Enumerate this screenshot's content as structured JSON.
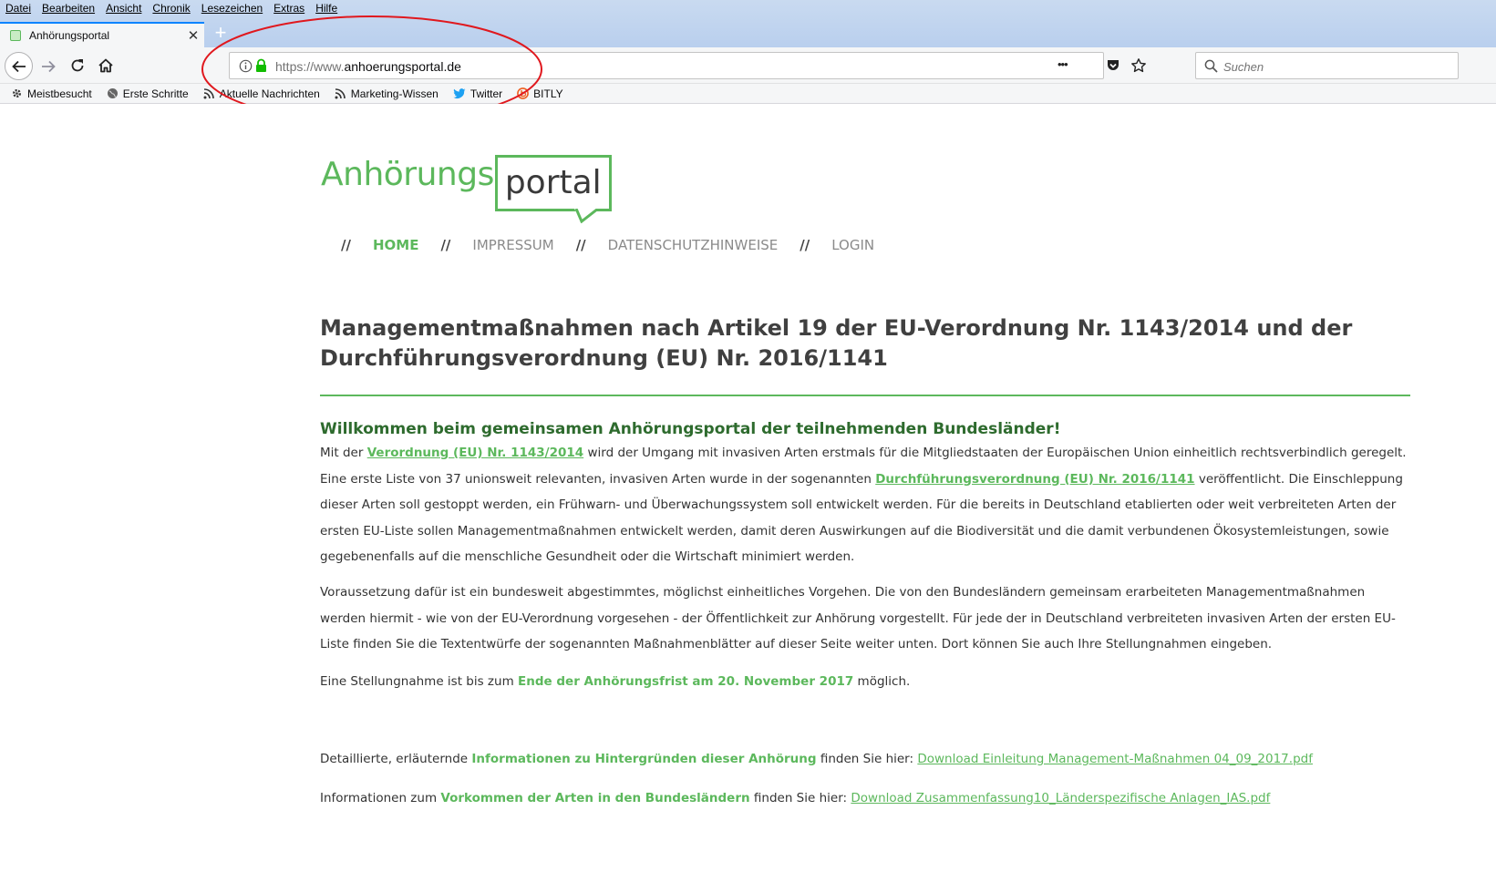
{
  "menu": [
    "Datei",
    "Bearbeiten",
    "Ansicht",
    "Chronik",
    "Lesezeichen",
    "Extras",
    "Hilfe"
  ],
  "tab": {
    "title": "Anhörungsportal",
    "close": "✕",
    "newtab": "+"
  },
  "urlbar": {
    "protocol": "https://www.",
    "domain": "anhoerungsportal.de",
    "more": "•••"
  },
  "search": {
    "placeholder": "Suchen"
  },
  "bookmarks": [
    "Meistbesucht",
    "Erste Schritte",
    "Aktuelle Nachrichten",
    "Marketing-Wissen",
    "Twitter",
    "BITLY"
  ],
  "logo": {
    "left": "Anhörungs",
    "right": "portal"
  },
  "nav": {
    "sep": "//",
    "items": [
      "HOME",
      "IMPRESSUM",
      "DATENSCHUTZHINWEISE",
      "LOGIN"
    ]
  },
  "title": "Managementmaßnahmen nach Artikel 19 der EU-Verordnung Nr. 1143/2014 und der Durchführungsverordnung (EU) Nr. 2016/1141",
  "welcome": "Willkommen beim gemeinsamen Anhörungsportal der teilnehmenden Bundesländer!",
  "para1": {
    "t1": "Mit der ",
    "link1": "Verordnung (EU) Nr. 1143/2014",
    "t2": " wird der Umgang mit invasiven Arten erstmals für die Mitgliedstaaten der Europäischen Union einheitlich rechtsverbindlich geregelt. Eine erste Liste von 37 unionsweit relevanten, invasiven Arten wurde in der sogenannten ",
    "link2": "Durchführungsverordnung (EU) Nr. 2016/1141",
    "t3": " veröffentlicht. Die Einschleppung dieser Arten soll gestoppt werden, ein Frühwarn- und Überwachungssystem soll entwickelt werden. Für die bereits in Deutschland etablierten oder weit verbreiteten Arten der ersten EU-Liste sollen Managementmaßnahmen entwickelt werden, damit deren Auswirkungen auf die Biodiversität und die damit verbundenen Ökosystemleistungen, sowie gegebenenfalls auf die menschliche Gesundheit oder die Wirtschaft minimiert werden."
  },
  "para2": "Voraussetzung dafür ist ein bundesweit abgestimmtes, möglichst einheitliches Vorgehen. Die von den Bundesländern gemeinsam erarbeiteten Managementmaßnahmen werden hiermit - wie von der EU-Verordnung vorgesehen - der Öffentlichkeit zur Anhörung vorgestellt. Für jede der in Deutschland verbreiteten invasiven Arten der ersten EU-Liste finden Sie die Textentwürfe der sogenannten Maßnahmenblätter auf dieser Seite weiter unten. Dort können Sie auch Ihre Stellungnahmen eingeben.",
  "para3": {
    "t1": "Eine Stellungnahme ist bis zum ",
    "bold": "Ende der Anhörungsfrist am 20. November 2017",
    "t2": " möglich."
  },
  "para4": {
    "t1": "Detaillierte, erläuternde ",
    "bold": "Informationen zu Hintergründen dieser Anhörung",
    "t2": " finden Sie hier: ",
    "link": " Download Einleitung Management-Maßnahmen 04_09_2017.pdf"
  },
  "para5": {
    "t1": "Informationen zum ",
    "bold": "Vorkommen der Arten in den Bundesländern",
    "t2": " finden Sie hier: ",
    "link": " Download Zusammenfassung10_Länderspezifische Anlagen_IAS.pdf"
  },
  "colors": {
    "accent": "#5cb85c",
    "annotation": "#e0181e"
  }
}
